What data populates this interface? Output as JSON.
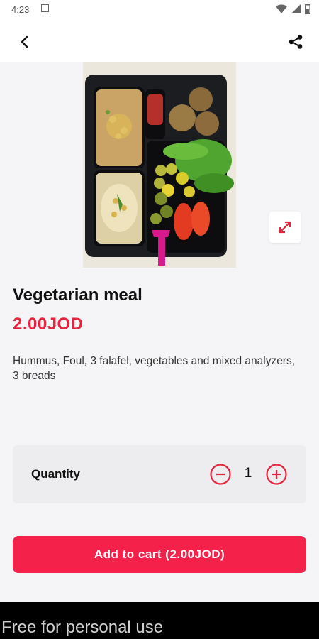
{
  "status_bar": {
    "time": "4:23",
    "icons": [
      "notification-icon",
      "wifi-icon",
      "signal-icon",
      "battery-icon"
    ]
  },
  "app_bar": {
    "back_icon": "back-arrow-icon",
    "share_icon": "share-icon"
  },
  "product": {
    "image_alt": "Vegetarian meal tray",
    "zoom_icon": "expand-icon",
    "title": "Vegetarian meal",
    "price": "2.00JOD",
    "description": "Hummus, Foul, 3 falafel, vegetables and mixed analyzers, 3 breads"
  },
  "quantity": {
    "label": "Quantity",
    "value": "1",
    "minus_icon": "minus-circle-icon",
    "plus_icon": "plus-circle-icon"
  },
  "cart": {
    "button_label": "Add to cart (2.00JOD)"
  },
  "watermark": "Free for personal use",
  "colors": {
    "accent": "#e8233e",
    "button": "#f4214a",
    "background": "#f5f5f7",
    "card": "#ededf0"
  }
}
